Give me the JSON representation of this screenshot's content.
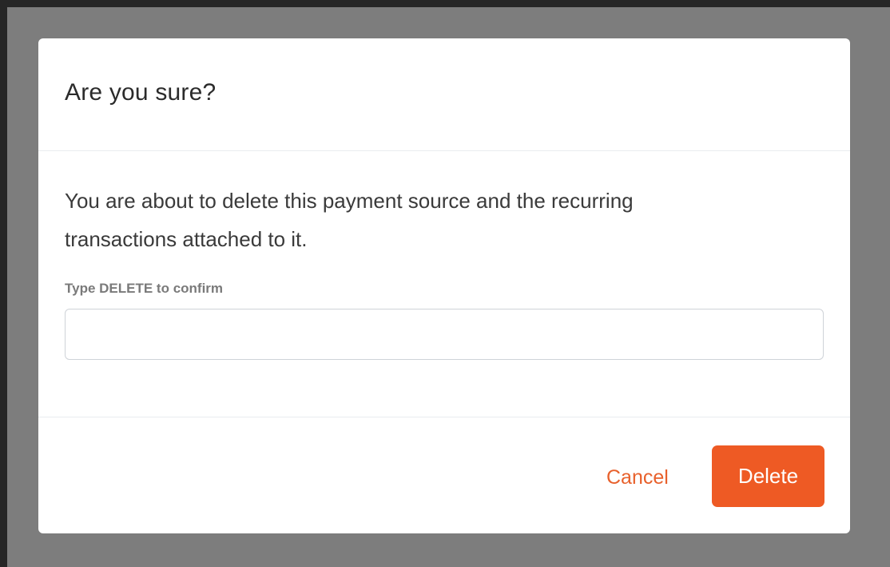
{
  "modal": {
    "title": "Are you sure?",
    "message_line1": "You are about to delete this payment source and the recurring",
    "message_line2": "transactions attached to it.",
    "confirm_label": "Type DELETE to confirm",
    "confirm_value": "",
    "confirm_placeholder": "",
    "cancel_label": "Cancel",
    "delete_label": "Delete"
  },
  "colors": {
    "accent": "#ee5a24",
    "backdrop": "#7d7d7d",
    "frame": "#262626"
  }
}
